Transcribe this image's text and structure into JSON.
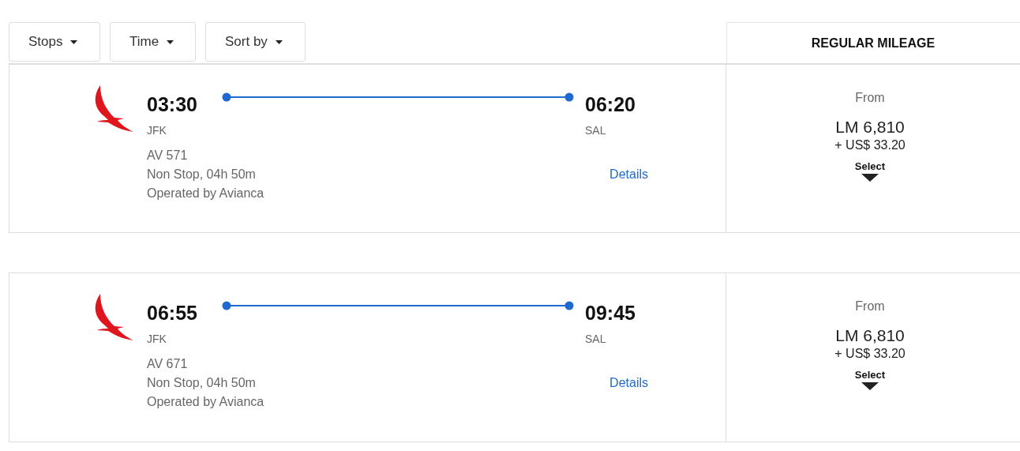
{
  "filters": [
    {
      "label": "Stops"
    },
    {
      "label": "Time"
    },
    {
      "label": "Sort by"
    }
  ],
  "fare_header": "REGULAR MILEAGE",
  "flights": [
    {
      "depart_time": "03:30",
      "depart_airport": "JFK",
      "arrive_time": "06:20",
      "arrive_airport": "SAL",
      "flight_number": "AV 571",
      "stops_duration": "Non Stop, 04h 50m",
      "operator": "Operated by Avianca",
      "details": "Details",
      "from": "From",
      "miles": "LM 6,810",
      "taxes": "+ US$ 33.20",
      "select": "Select"
    },
    {
      "depart_time": "06:55",
      "depart_airport": "JFK",
      "arrive_time": "09:45",
      "arrive_airport": "SAL",
      "flight_number": "AV 671",
      "stops_duration": "Non Stop, 04h 50m",
      "operator": "Operated by Avianca",
      "details": "Details",
      "from": "From",
      "miles": "LM 6,810",
      "taxes": "+ US$ 33.20",
      "select": "Select"
    }
  ]
}
